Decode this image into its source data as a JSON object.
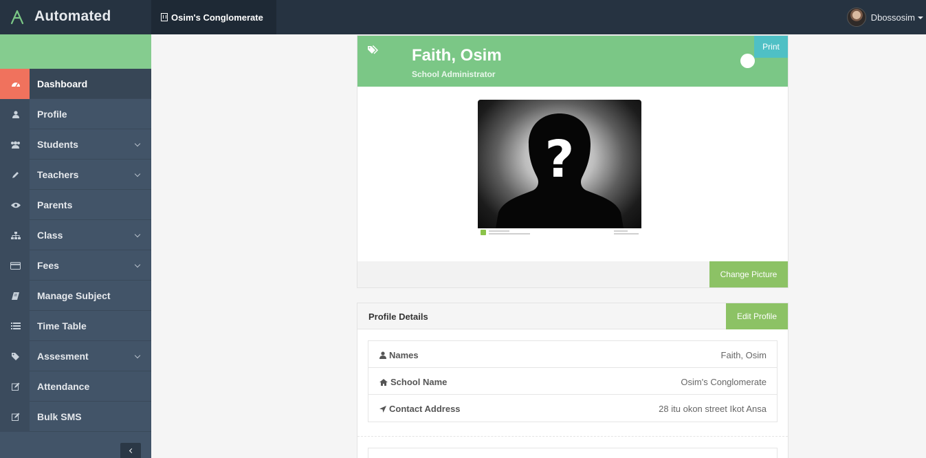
{
  "app": {
    "title": "Automated",
    "organization": "Osim's Conglomerate",
    "user": "Dbossosim",
    "accent": "#7bc786"
  },
  "sidebar": {
    "items": [
      {
        "label": "Dashboard",
        "icon": "dashboard-icon",
        "active": true,
        "has_submenu": false
      },
      {
        "label": "Profile",
        "icon": "user-icon",
        "has_submenu": false
      },
      {
        "label": "Students",
        "icon": "users-icon",
        "has_submenu": true
      },
      {
        "label": "Teachers",
        "icon": "pencil-icon",
        "has_submenu": true
      },
      {
        "label": "Parents",
        "icon": "eye-icon",
        "has_submenu": false
      },
      {
        "label": "Class",
        "icon": "sitemap-icon",
        "has_submenu": true
      },
      {
        "label": "Fees",
        "icon": "credit-card-icon",
        "has_submenu": true
      },
      {
        "label": "Manage Subject",
        "icon": "book-icon",
        "has_submenu": false
      },
      {
        "label": "Time Table",
        "icon": "list-icon",
        "has_submenu": false
      },
      {
        "label": "Assesment",
        "icon": "tags-icon",
        "has_submenu": true
      },
      {
        "label": "Attendance",
        "icon": "edit-icon",
        "has_submenu": false
      },
      {
        "label": "Bulk SMS",
        "icon": "edit-icon",
        "has_submenu": false
      }
    ]
  },
  "profile_card": {
    "name": "Faith, Osim",
    "role": "School Administrator",
    "print_label": "Print",
    "change_picture_label": "Change Picture"
  },
  "details_card": {
    "title": "Profile Details",
    "edit_label": "Edit Profile",
    "rows": [
      {
        "label": "Names",
        "icon": "user-icon",
        "value": "Faith, Osim"
      },
      {
        "label": "School Name",
        "icon": "home-icon",
        "value": "Osim's Conglomerate"
      },
      {
        "label": "Contact Address",
        "icon": "location-arrow-icon",
        "value": "28 itu okon street Ikot Ansa"
      }
    ]
  }
}
